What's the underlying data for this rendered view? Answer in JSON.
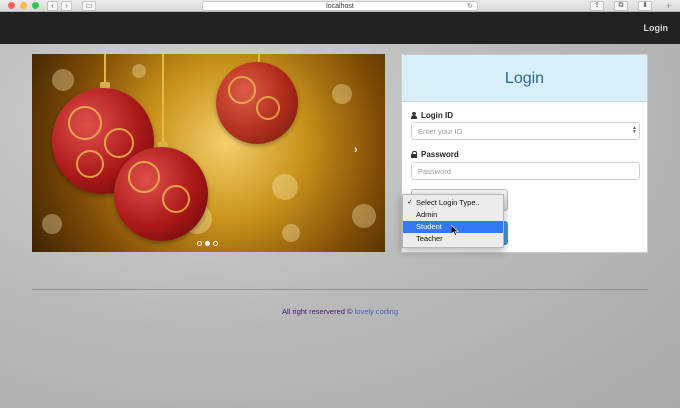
{
  "browser": {
    "url": "localhost",
    "back_icon": "chevron-left-icon",
    "forward_icon": "chevron-right-icon"
  },
  "navbar": {
    "login_link": "Login"
  },
  "carousel": {
    "slide_count": 3,
    "active_slide": 2
  },
  "login": {
    "title": "Login",
    "login_id_label": "Login ID",
    "login_id_placeholder": "Enter your ID",
    "password_label": "Password",
    "password_placeholder": "Password"
  },
  "dropdown": {
    "options": [
      "Select Login Type..",
      "Admin",
      "Student",
      "Teacher"
    ],
    "checked_option": "Select Login Type..",
    "highlighted_option": "Student"
  },
  "footer": {
    "text": "All right reservered ©",
    "link": "lovely coding"
  },
  "colors": {
    "navbar": "#222222",
    "login_header": "#d8eef8",
    "highlight": "#3478f6",
    "footer_text": "#3b1970",
    "footer_link": "#4a5fc1"
  }
}
